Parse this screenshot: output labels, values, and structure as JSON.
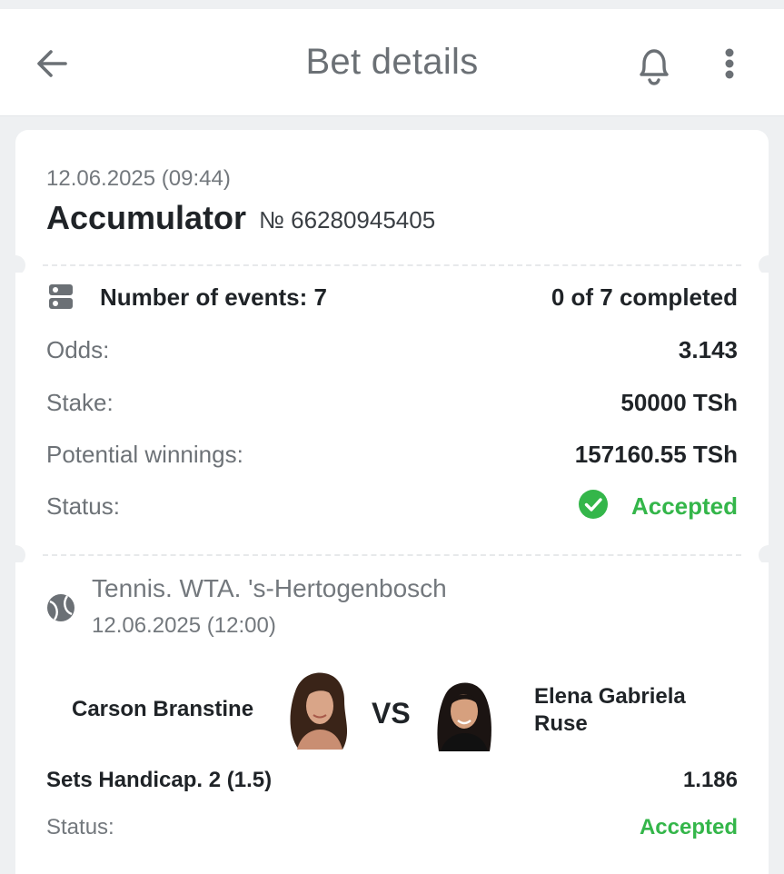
{
  "header": {
    "title": "Bet details",
    "back_icon": "arrow-left-icon",
    "bell_icon": "bell-icon",
    "more_icon": "more-vertical-icon"
  },
  "bet": {
    "date": "12.06.2025 (09:44)",
    "type": "Accumulator",
    "number": "№ 66280945405"
  },
  "summary": {
    "events_label": "Number of events: 7",
    "completed": "0 of 7 completed",
    "odds_label": "Odds:",
    "odds_value": "3.143",
    "stake_label": "Stake:",
    "stake_value": "50000 TSh",
    "winnings_label": "Potential winnings:",
    "winnings_value": "157160.55 TSh",
    "status_label": "Status:",
    "status_value": "Accepted"
  },
  "event": {
    "league": "Tennis. WTA. 's-Hertogenbosch",
    "date": "12.06.2025 (12:00)",
    "player1": "Carson Branstine",
    "vs": "VS",
    "player2": "Elena Gabriela Ruse",
    "market": "Sets Handicap. 2 (1.5)",
    "odds": "1.186",
    "status_label": "Status:",
    "status_value": "Accepted"
  },
  "colors": {
    "accent_green": "#34b64a",
    "background": "#eef0f2",
    "card": "#ffffff"
  }
}
